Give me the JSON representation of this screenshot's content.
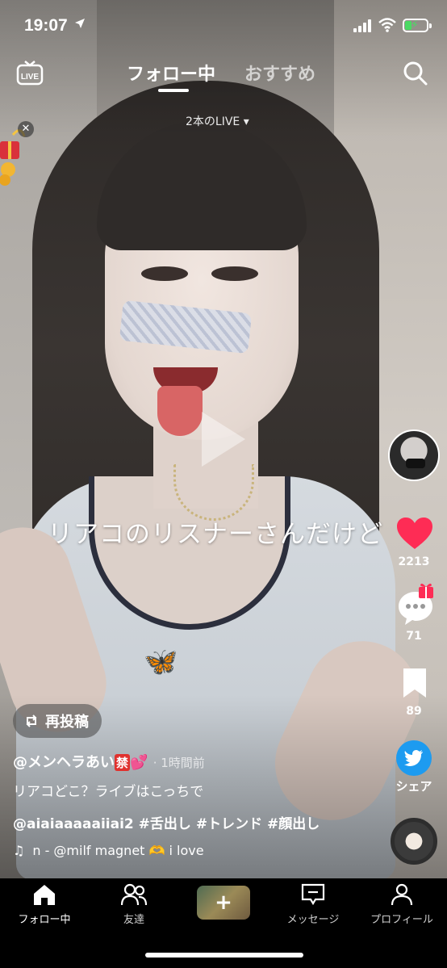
{
  "status_bar": {
    "time": "19:07"
  },
  "top_nav": {
    "live_label": "LIVE",
    "tabs": [
      {
        "label": "フォロー中",
        "active": true
      },
      {
        "label": "おすすめ",
        "active": false
      }
    ],
    "live_count": "2本のLIVE ▾"
  },
  "video": {
    "caption": "リアコのリスナーさんだけど"
  },
  "right_rail": {
    "likes": "2213",
    "comments": "71",
    "bookmarks": "89",
    "share_label": "シェア",
    "like_color": "#fe2c55",
    "share_color": "#1d9bf0"
  },
  "post": {
    "repost_label": "再投稿",
    "author": "@メンヘラあい",
    "author_badge": "禁",
    "author_emoji": "💕",
    "time_ago": "· 1時間前",
    "description": "リアコどこ？ライブはこっちで",
    "tags": "@aiaiaaaaaiiai2 #舌出し #トレンド #顔出し",
    "music_text": "n - @milf magnet 🫶     i love"
  },
  "tab_bar": {
    "items": [
      {
        "label": "フォロー中"
      },
      {
        "label": "友達"
      },
      {
        "label": "+"
      },
      {
        "label": "メッセージ"
      },
      {
        "label": "プロフィール"
      }
    ]
  }
}
